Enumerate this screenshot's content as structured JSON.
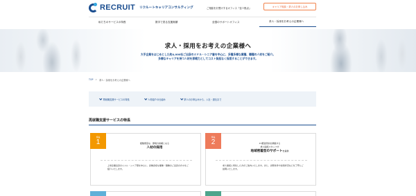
{
  "header": {
    "logo_text": "RECRUIT",
    "logo_sub": "リクルートキャリアコンサルティング",
    "link_text": "ご相談をお受けするオフィス「全３拠点」",
    "cta_label": "キャリア相談・求人のお申し込み"
  },
  "nav": {
    "items": [
      {
        "label": "私たちのサービスの特長"
      },
      {
        "label": "数字で見る支援実績"
      },
      {
        "label": "全国のサポートオフィス"
      },
      {
        "label": "求人・採用をお考えの企業様へ"
      }
    ]
  },
  "hero": {
    "title": "求人・採用をお考えの企業様へ",
    "lines": [
      "大手企業をはじめとした約4,000社ご出身のミドル・シニア層を中心に、多種多様な業種、職種の人材をご紹介。",
      "多様なキャリアを持つ人材を即戦力としてコスト負担なく採用することができます。"
    ]
  },
  "breadcrumb": {
    "home": "TOP",
    "separator": ">",
    "current": "求人・採用をお考えの企業様へ"
  },
  "anchors": [
    {
      "label": "再就職支援サービスの特長"
    },
    {
      "label": "人材紹介の仕組み"
    },
    {
      "label": "求人のお申込みから、入社・退社まで"
    }
  ],
  "section": {
    "title": "再就職支援サービスの特長"
  },
  "cards": [
    {
      "badge_label": "特長",
      "badge_number": "1",
      "sub": "経験豊富な、即戦力候補となる",
      "main": "人材の採用",
      "main_small": "",
      "body": "上場企業出身のミドル・シニア層を中心に、多種多様な業種・職種のご出身の方々をご紹介いたします。"
    },
    {
      "badge_label": "特長",
      "badge_number": "2",
      "sub": "47都道府県を網羅する",
      "sub2": "求人開拓スタッフが",
      "main": "地域密着型のサポート",
      "main_small": "を提供",
      "body": "求人開拓に特化した方がご案内いたします。また、労務条件や採用状況などを丁寧にご説明いたします。"
    }
  ],
  "colors": {
    "brand": "#1a4d8f",
    "badge1": "#f39800",
    "badge2": "#ee7b5b",
    "badge3": "#5fb0d8",
    "badge4": "#4da58c",
    "cta": "#e8693c"
  }
}
